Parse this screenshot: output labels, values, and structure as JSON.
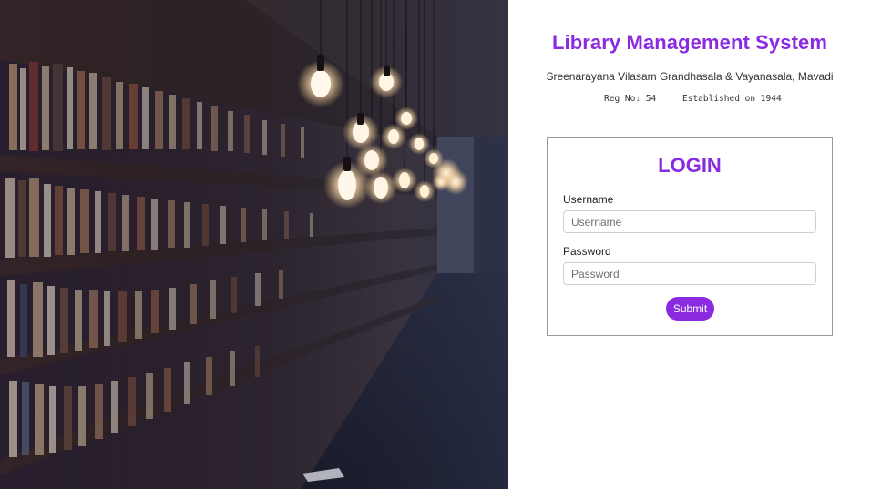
{
  "header": {
    "title": "Library Management System",
    "subtitle": "Sreenarayana Vilasam Grandhasala & Vayanasala, Mavadi",
    "reg_no": "Reg No: 54",
    "established": "Established on 1944"
  },
  "login": {
    "title": "LOGIN",
    "username_label": "Username",
    "username_placeholder": "Username",
    "password_label": "Password",
    "password_placeholder": "Password",
    "submit_label": "Submit"
  },
  "colors": {
    "accent": "#8a2be2"
  },
  "images": {
    "hero": "library-bookshelves-with-hanging-bulbs-photo"
  }
}
